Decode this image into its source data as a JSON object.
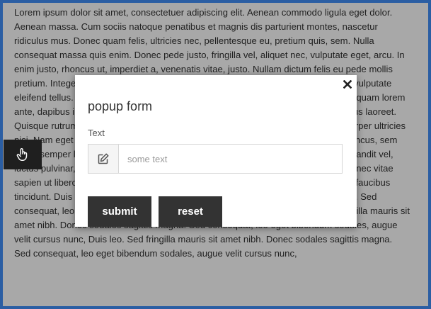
{
  "page": {
    "body_text": "Lorem ipsum dolor sit amet, consectetuer adipiscing elit. Aenean commodo ligula eget dolor. Aenean massa. Cum sociis natoque penatibus et magnis dis parturient montes, nascetur ridiculus mus. Donec quam felis, ultricies nec, pellentesque eu, pretium quis, sem. Nulla consequat massa quis enim. Donec pede justo, fringilla vel, aliquet nec, vulputate eget, arcu. In enim justo, rhoncus ut, imperdiet a, venenatis vitae, justo. Nullam dictum felis eu pede mollis pretium. Integer tincidunt. Cras dapibus. Vivamus elementum semper nisi. Aenean vulputate eleifend tellus. Aenean leo ligula, porttitor eu, consequat vitae, eleifend ac, enim. Aliquam lorem ante, dapibus in, viverra quis, feugiat a, tellus. Phasellus viverra nulla ut metus varius laoreet. Quisque rutrum. Aenean imperdiet. Etiam ultricies nisi vel augue. Curabitur ullamcorper ultricies nisi. Nam eget dui. Etiam rhoncus. Maecenas tempus, tellus eget condimentum rhoncus, sem quam semper libero, sit amet adipiscing sem neque sed ipsum. Nam quam nunc, blandit vel, luctus pulvinar, hendrerit id, lorem. Maecenas nec odio et ante tincidunt tempus. Donec vitae sapien ut libero venenatis faucibus. Nullam quis ante. Etiam sit amet orci eget eros faucibus tincidunt. Duis leo. Sed fringilla mauris sit amet nibh. Donec sodales sagittis magna. Sed consequat, leo eget bibendum sodales, augue velit cursus nunc, Duis leo. Sed fringilla mauris sit amet nibh. Donec sodales sagittis magna. Sed consequat, leo eget bibendum sodales, augue velit cursus nunc, Duis leo. Sed fringilla mauris sit amet nibh. Donec sodales sagittis magna. Sed consequat, leo eget bibendum sodales, augue velit cursus nunc,"
  },
  "side_tab": {
    "icon": "hand-pointer-icon"
  },
  "popup": {
    "title": "popup form",
    "close_icon": "close-icon",
    "field": {
      "label": "Text",
      "icon": "edit-icon",
      "value": "",
      "placeholder": "some text"
    },
    "buttons": {
      "submit_label": "submit",
      "reset_label": "reset"
    }
  },
  "colors": {
    "frame_border": "#2b5ea3",
    "button_bg": "#333333",
    "side_tab_bg": "#1f1f1f"
  }
}
